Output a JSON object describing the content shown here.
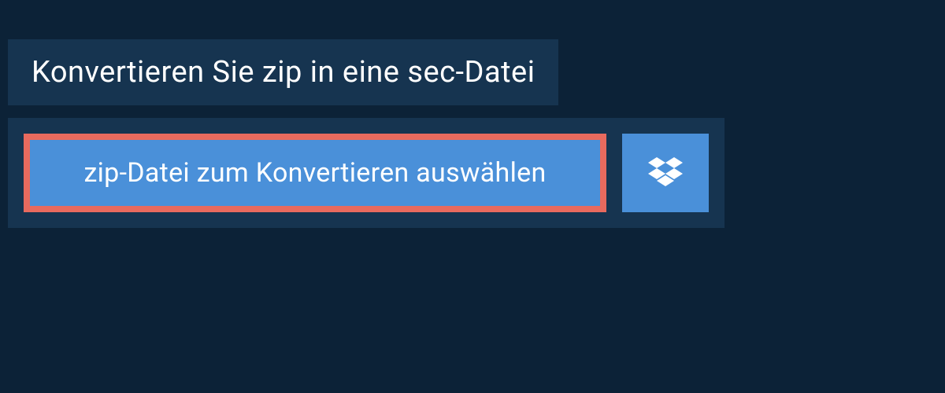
{
  "title": "Konvertieren Sie zip in eine sec-Datei",
  "buttons": {
    "select_file": "zip-Datei zum Konvertieren auswählen"
  },
  "colors": {
    "background": "#0c2237",
    "panel": "#163450",
    "button": "#4a90d9",
    "highlight_border": "#e86a5e",
    "text": "#ffffff"
  }
}
